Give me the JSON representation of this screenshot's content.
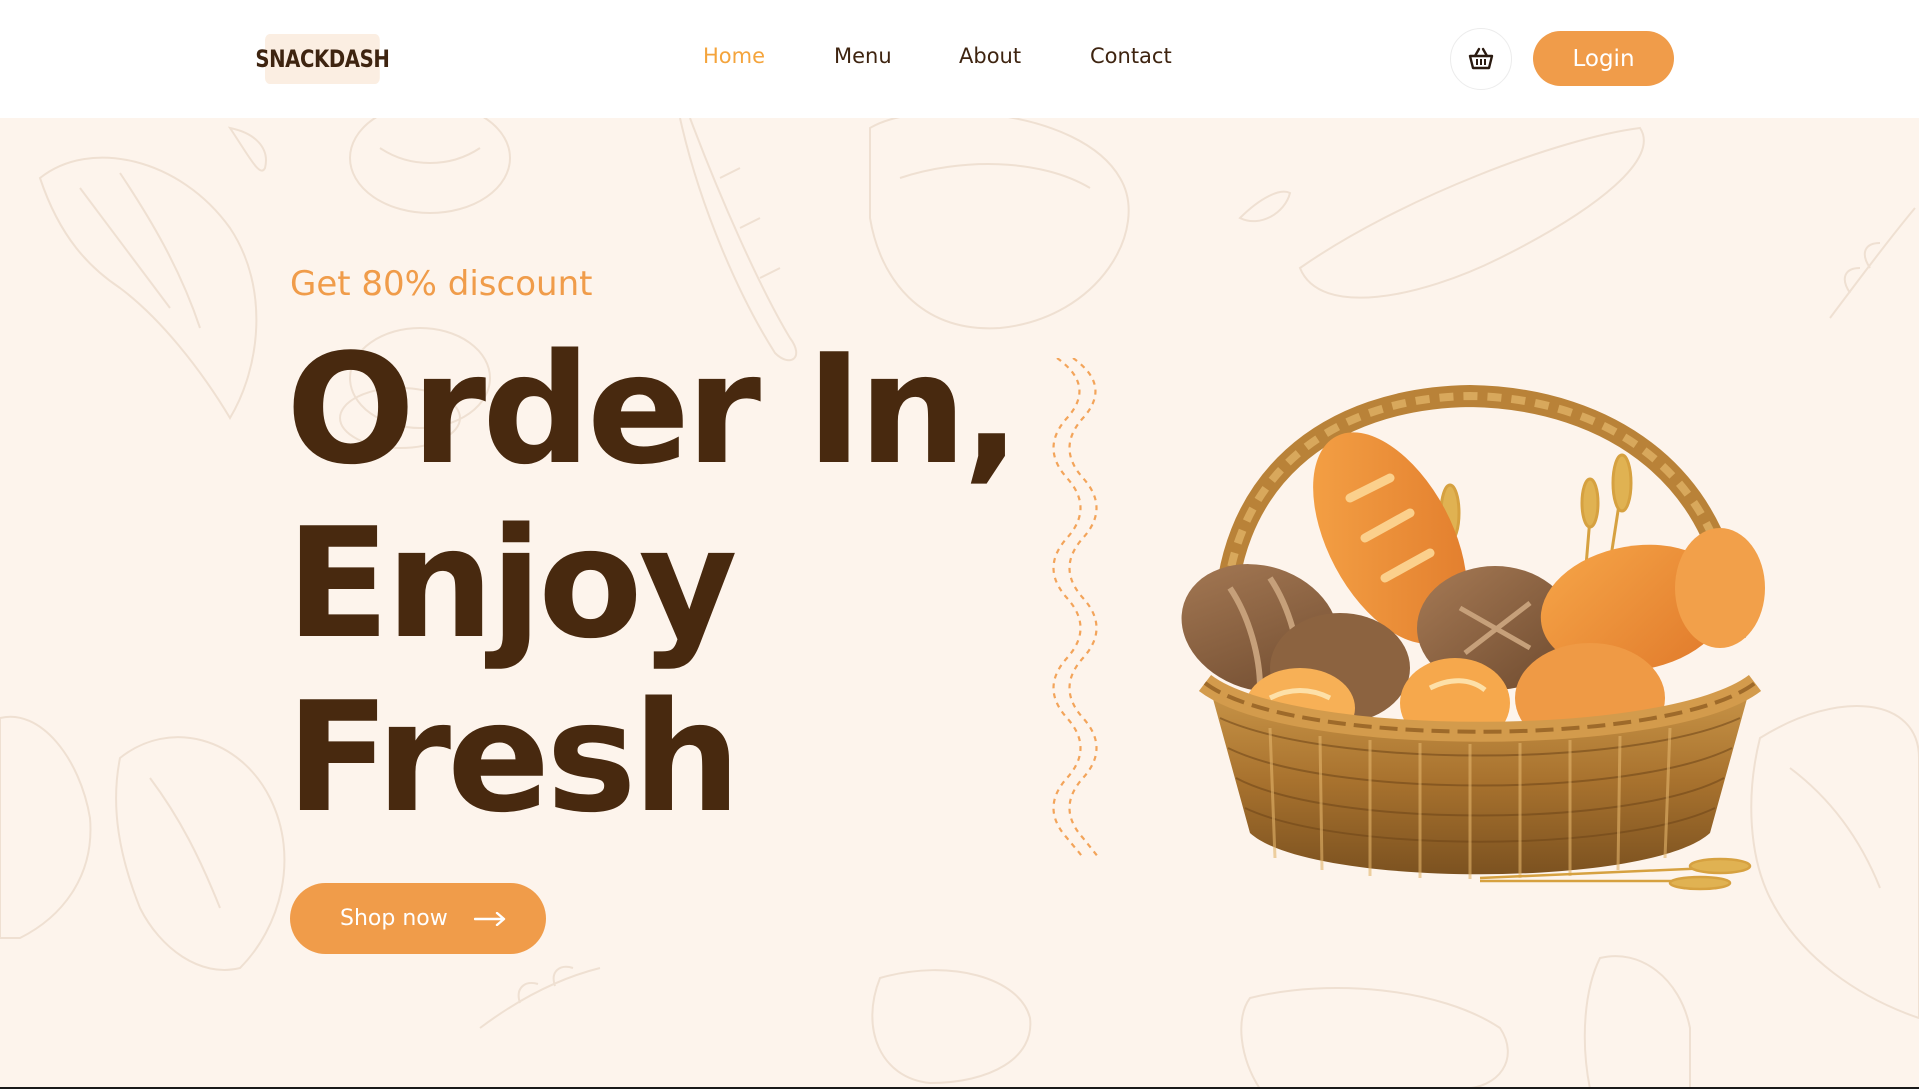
{
  "brand": {
    "logo_text": "SNACKDASH"
  },
  "nav": {
    "items": [
      {
        "label": "Home",
        "active": true
      },
      {
        "label": "Menu",
        "active": false
      },
      {
        "label": "About",
        "active": false
      },
      {
        "label": "Contact",
        "active": false
      }
    ],
    "cart_icon": "basket-icon",
    "login_label": "Login"
  },
  "hero": {
    "eyebrow": "Get 80% discount",
    "headline": [
      "Order In,",
      "Enjoy",
      "Fresh"
    ],
    "cta_label": "Shop now",
    "cta_icon": "arrow-right-icon",
    "illustration": "bread-basket-illustration"
  },
  "colors": {
    "accent": "#f09c4a",
    "active_nav": "#f4a43c",
    "heading": "#48290f",
    "hero_bg": "#fdf4ec",
    "nav_bg": "#ffffff"
  }
}
